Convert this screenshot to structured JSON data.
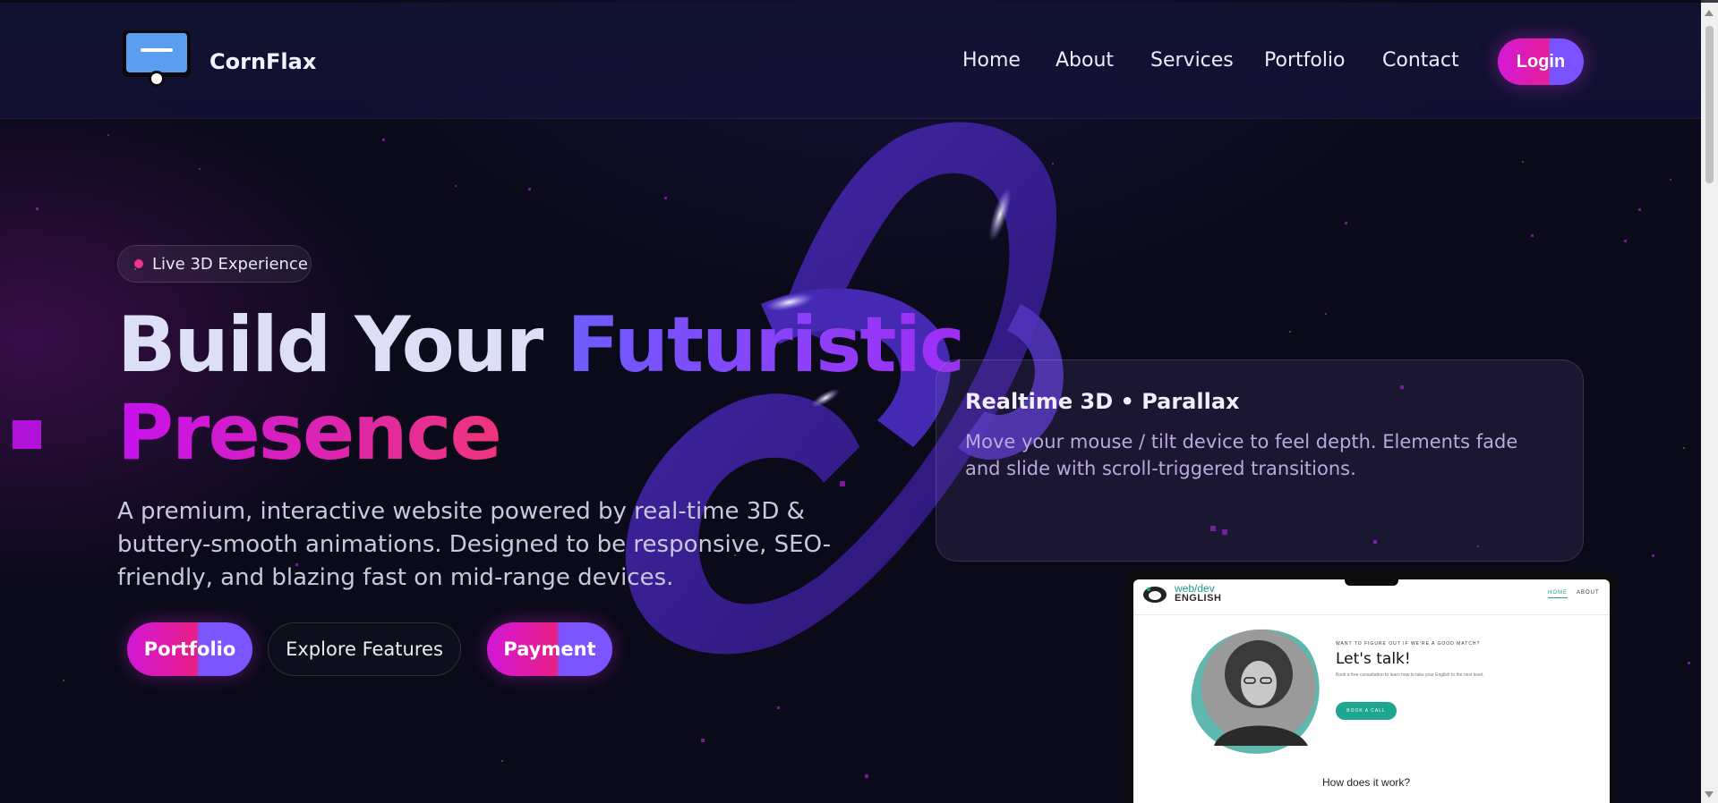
{
  "header": {
    "brand": "CornFlax",
    "nav": [
      "Home",
      "About",
      "Services",
      "Portfolio",
      "Contact"
    ],
    "login_label": "Login"
  },
  "hero": {
    "badge": "Live 3D Experience",
    "title_part1": "Build Your ",
    "title_part2": "Futuristic",
    "title_part3": "Presence",
    "lead": "A premium, interactive website powered by real-time 3D & buttery-smooth animations. Designed to be responsive, SEO-friendly, and blazing fast on mid-range devices.",
    "buttons": {
      "portfolio": "Portfolio",
      "explore": "Explore Features",
      "payment": "Payment"
    }
  },
  "card": {
    "title": "Realtime 3D • Parallax",
    "text": "Move your mouse / tilt device to feel depth. Elements fade and slide with scroll-triggered transitions."
  },
  "preview": {
    "brand_line1": "web/dev",
    "brand_line2": "ENGLISH",
    "nav_home": "HOME",
    "nav_about": "ABOUT",
    "kicker": "WANT TO FIGURE OUT IF WE'RE A GOOD MATCH?",
    "heading": "Let's talk!",
    "body": "Book a free consultation to learn how to take your English to the next level.",
    "cta": "BOOK A CALL",
    "question": "How does it work?"
  },
  "colors": {
    "background": "#0a0a18",
    "accent_pink": "#e91e85",
    "accent_magenta": "#d117d8",
    "accent_violet": "#7b55ff",
    "preview_teal": "#1f9c8c"
  },
  "icons": {
    "logo": "monitor-icon",
    "badge_dot": "status-dot-icon"
  }
}
